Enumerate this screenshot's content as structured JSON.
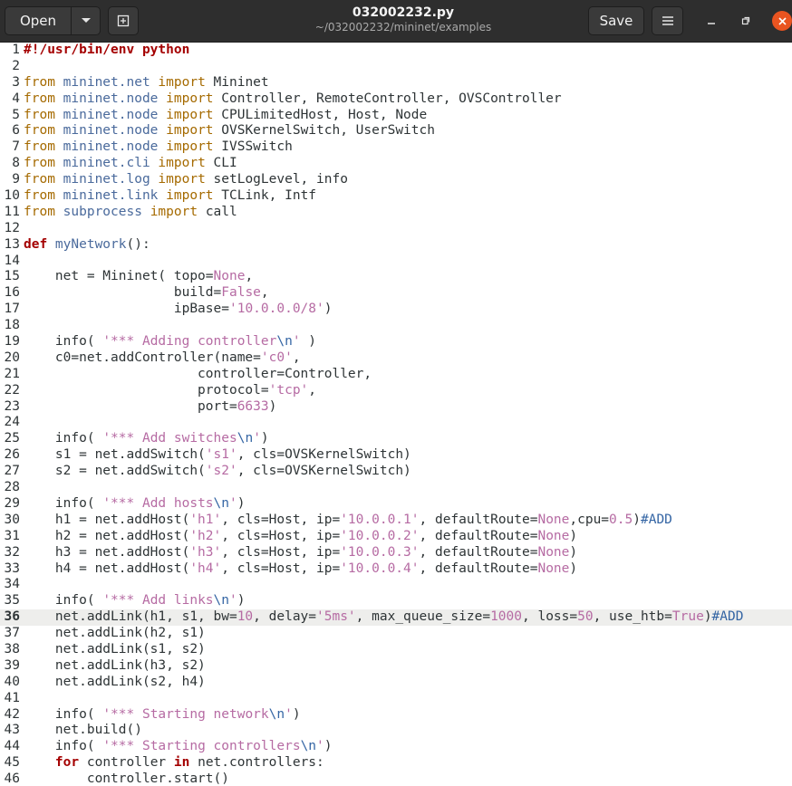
{
  "header": {
    "open_label": "Open",
    "title": "032002232.py",
    "subtitle": "~/032002232/mininet/examples",
    "save_label": "Save"
  },
  "editor": {
    "current_line": 36,
    "lines": [
      {
        "n": "1",
        "t": [
          [
            "kw",
            "#!/usr/bin/env python"
          ]
        ]
      },
      {
        "n": "2",
        "t": []
      },
      {
        "n": "3",
        "t": [
          [
            "imp",
            "from "
          ],
          [
            "mod",
            "mininet.net"
          ],
          [
            "imp",
            " import "
          ],
          [
            "",
            "Mininet"
          ]
        ]
      },
      {
        "n": "4",
        "t": [
          [
            "imp",
            "from "
          ],
          [
            "mod",
            "mininet.node"
          ],
          [
            "imp",
            " import "
          ],
          [
            "",
            "Controller, RemoteController, OVSController"
          ]
        ]
      },
      {
        "n": "5",
        "t": [
          [
            "imp",
            "from "
          ],
          [
            "mod",
            "mininet.node"
          ],
          [
            "imp",
            " import "
          ],
          [
            "",
            "CPULimitedHost, Host, Node"
          ]
        ]
      },
      {
        "n": "6",
        "t": [
          [
            "imp",
            "from "
          ],
          [
            "mod",
            "mininet.node"
          ],
          [
            "imp",
            " import "
          ],
          [
            "",
            "OVSKernelSwitch, UserSwitch"
          ]
        ]
      },
      {
        "n": "7",
        "t": [
          [
            "imp",
            "from "
          ],
          [
            "mod",
            "mininet.node"
          ],
          [
            "imp",
            " import "
          ],
          [
            "",
            "IVSSwitch"
          ]
        ]
      },
      {
        "n": "8",
        "t": [
          [
            "imp",
            "from "
          ],
          [
            "mod",
            "mininet.cli"
          ],
          [
            "imp",
            " import "
          ],
          [
            "",
            "CLI"
          ]
        ]
      },
      {
        "n": "9",
        "t": [
          [
            "imp",
            "from "
          ],
          [
            "mod",
            "mininet.log"
          ],
          [
            "imp",
            " import "
          ],
          [
            "",
            "setLogLevel, info"
          ]
        ]
      },
      {
        "n": "10",
        "t": [
          [
            "imp",
            "from "
          ],
          [
            "mod",
            "mininet.link"
          ],
          [
            "imp",
            " import "
          ],
          [
            "",
            "TCLink, Intf"
          ]
        ]
      },
      {
        "n": "11",
        "t": [
          [
            "imp",
            "from "
          ],
          [
            "mod",
            "subprocess"
          ],
          [
            "imp",
            " import "
          ],
          [
            "",
            "call"
          ]
        ]
      },
      {
        "n": "12",
        "t": []
      },
      {
        "n": "13",
        "t": [
          [
            "kw",
            "def "
          ],
          [
            "mod",
            "myNetwork"
          ],
          [
            "",
            "():"
          ]
        ]
      },
      {
        "n": "14",
        "t": []
      },
      {
        "n": "15",
        "t": [
          [
            "",
            "    net = Mininet( topo="
          ],
          [
            "const",
            "None"
          ],
          [
            "",
            ","
          ]
        ]
      },
      {
        "n": "16",
        "t": [
          [
            "",
            "                   build="
          ],
          [
            "const",
            "False"
          ],
          [
            "",
            ","
          ]
        ]
      },
      {
        "n": "17",
        "t": [
          [
            "",
            "                   ipBase="
          ],
          [
            "str",
            "'10.0.0.0/8'"
          ],
          [
            "",
            ")"
          ]
        ]
      },
      {
        "n": "18",
        "t": []
      },
      {
        "n": "19",
        "t": [
          [
            "",
            "    info( "
          ],
          [
            "str",
            "'*** Adding controller"
          ],
          [
            "sb",
            "\\n"
          ],
          [
            "str",
            "'"
          ],
          [
            "",
            " )"
          ]
        ]
      },
      {
        "n": "20",
        "t": [
          [
            "",
            "    c0=net.addController(name="
          ],
          [
            "str",
            "'c0'"
          ],
          [
            "",
            ","
          ]
        ]
      },
      {
        "n": "21",
        "t": [
          [
            "",
            "                      controller=Controller,"
          ]
        ]
      },
      {
        "n": "22",
        "t": [
          [
            "",
            "                      protocol="
          ],
          [
            "str",
            "'tcp'"
          ],
          [
            "",
            ","
          ]
        ]
      },
      {
        "n": "23",
        "t": [
          [
            "",
            "                      port="
          ],
          [
            "num",
            "6633"
          ],
          [
            "",
            ")"
          ]
        ]
      },
      {
        "n": "24",
        "t": []
      },
      {
        "n": "25",
        "t": [
          [
            "",
            "    info( "
          ],
          [
            "str",
            "'*** Add switches"
          ],
          [
            "sb",
            "\\n"
          ],
          [
            "str",
            "'"
          ],
          [
            "",
            ")"
          ]
        ]
      },
      {
        "n": "26",
        "t": [
          [
            "",
            "    s1 = net.addSwitch("
          ],
          [
            "str",
            "'s1'"
          ],
          [
            "",
            ", cls=OVSKernelSwitch)"
          ]
        ]
      },
      {
        "n": "27",
        "t": [
          [
            "",
            "    s2 = net.addSwitch("
          ],
          [
            "str",
            "'s2'"
          ],
          [
            "",
            ", cls=OVSKernelSwitch)"
          ]
        ]
      },
      {
        "n": "28",
        "t": []
      },
      {
        "n": "29",
        "t": [
          [
            "",
            "    info( "
          ],
          [
            "str",
            "'*** Add hosts"
          ],
          [
            "sb",
            "\\n"
          ],
          [
            "str",
            "'"
          ],
          [
            "",
            ")"
          ]
        ]
      },
      {
        "n": "30",
        "t": [
          [
            "",
            "    h1 = net.addHost("
          ],
          [
            "str",
            "'h1'"
          ],
          [
            "",
            ", cls=Host, ip="
          ],
          [
            "str",
            "'10.0.0.1'"
          ],
          [
            "",
            ", defaultRoute="
          ],
          [
            "const",
            "None"
          ],
          [
            "",
            ",cpu="
          ],
          [
            "num",
            "0.5"
          ],
          [
            "",
            ")"
          ],
          [
            "cmt",
            "#ADD"
          ]
        ]
      },
      {
        "n": "31",
        "t": [
          [
            "",
            "    h2 = net.addHost("
          ],
          [
            "str",
            "'h2'"
          ],
          [
            "",
            ", cls=Host, ip="
          ],
          [
            "str",
            "'10.0.0.2'"
          ],
          [
            "",
            ", defaultRoute="
          ],
          [
            "const",
            "None"
          ],
          [
            "",
            ")"
          ]
        ]
      },
      {
        "n": "32",
        "t": [
          [
            "",
            "    h3 = net.addHost("
          ],
          [
            "str",
            "'h3'"
          ],
          [
            "",
            ", cls=Host, ip="
          ],
          [
            "str",
            "'10.0.0.3'"
          ],
          [
            "",
            ", defaultRoute="
          ],
          [
            "const",
            "None"
          ],
          [
            "",
            ")"
          ]
        ]
      },
      {
        "n": "33",
        "t": [
          [
            "",
            "    h4 = net.addHost("
          ],
          [
            "str",
            "'h4'"
          ],
          [
            "",
            ", cls=Host, ip="
          ],
          [
            "str",
            "'10.0.0.4'"
          ],
          [
            "",
            ", defaultRoute="
          ],
          [
            "const",
            "None"
          ],
          [
            "",
            ")"
          ]
        ]
      },
      {
        "n": "34",
        "t": []
      },
      {
        "n": "35",
        "t": [
          [
            "",
            "    info( "
          ],
          [
            "str",
            "'*** Add links"
          ],
          [
            "sb",
            "\\n"
          ],
          [
            "str",
            "'"
          ],
          [
            "",
            ")"
          ]
        ]
      },
      {
        "n": "36",
        "t": [
          [
            "",
            "    net.addLink(h1, s1, bw="
          ],
          [
            "num",
            "10"
          ],
          [
            "",
            ", delay="
          ],
          [
            "str",
            "'5ms'"
          ],
          [
            "",
            ", max_queue_size="
          ],
          [
            "num",
            "1000"
          ],
          [
            "",
            ", loss="
          ],
          [
            "num",
            "50"
          ],
          [
            "",
            ", use_htb="
          ],
          [
            "const",
            "True"
          ],
          [
            "",
            ")"
          ],
          [
            "cmt",
            "#ADD"
          ]
        ]
      },
      {
        "n": "37",
        "t": [
          [
            "",
            "    net.addLink(h2, s1)"
          ]
        ]
      },
      {
        "n": "38",
        "t": [
          [
            "",
            "    net.addLink(s1, s2)"
          ]
        ]
      },
      {
        "n": "39",
        "t": [
          [
            "",
            "    net.addLink(h3, s2)"
          ]
        ]
      },
      {
        "n": "40",
        "t": [
          [
            "",
            "    net.addLink(s2, h4)"
          ]
        ]
      },
      {
        "n": "41",
        "t": []
      },
      {
        "n": "42",
        "t": [
          [
            "",
            "    info( "
          ],
          [
            "str",
            "'*** Starting network"
          ],
          [
            "sb",
            "\\n"
          ],
          [
            "str",
            "'"
          ],
          [
            "",
            ")"
          ]
        ]
      },
      {
        "n": "43",
        "t": [
          [
            "",
            "    net.build()"
          ]
        ]
      },
      {
        "n": "44",
        "t": [
          [
            "",
            "    info( "
          ],
          [
            "str",
            "'*** Starting controllers"
          ],
          [
            "sb",
            "\\n"
          ],
          [
            "str",
            "'"
          ],
          [
            "",
            ")"
          ]
        ]
      },
      {
        "n": "45",
        "t": [
          [
            "",
            "    "
          ],
          [
            "kw",
            "for"
          ],
          [
            "",
            " controller "
          ],
          [
            "kw",
            "in"
          ],
          [
            "",
            " net.controllers:"
          ]
        ]
      },
      {
        "n": "46",
        "t": [
          [
            "",
            "        controller.start()"
          ]
        ]
      }
    ]
  }
}
